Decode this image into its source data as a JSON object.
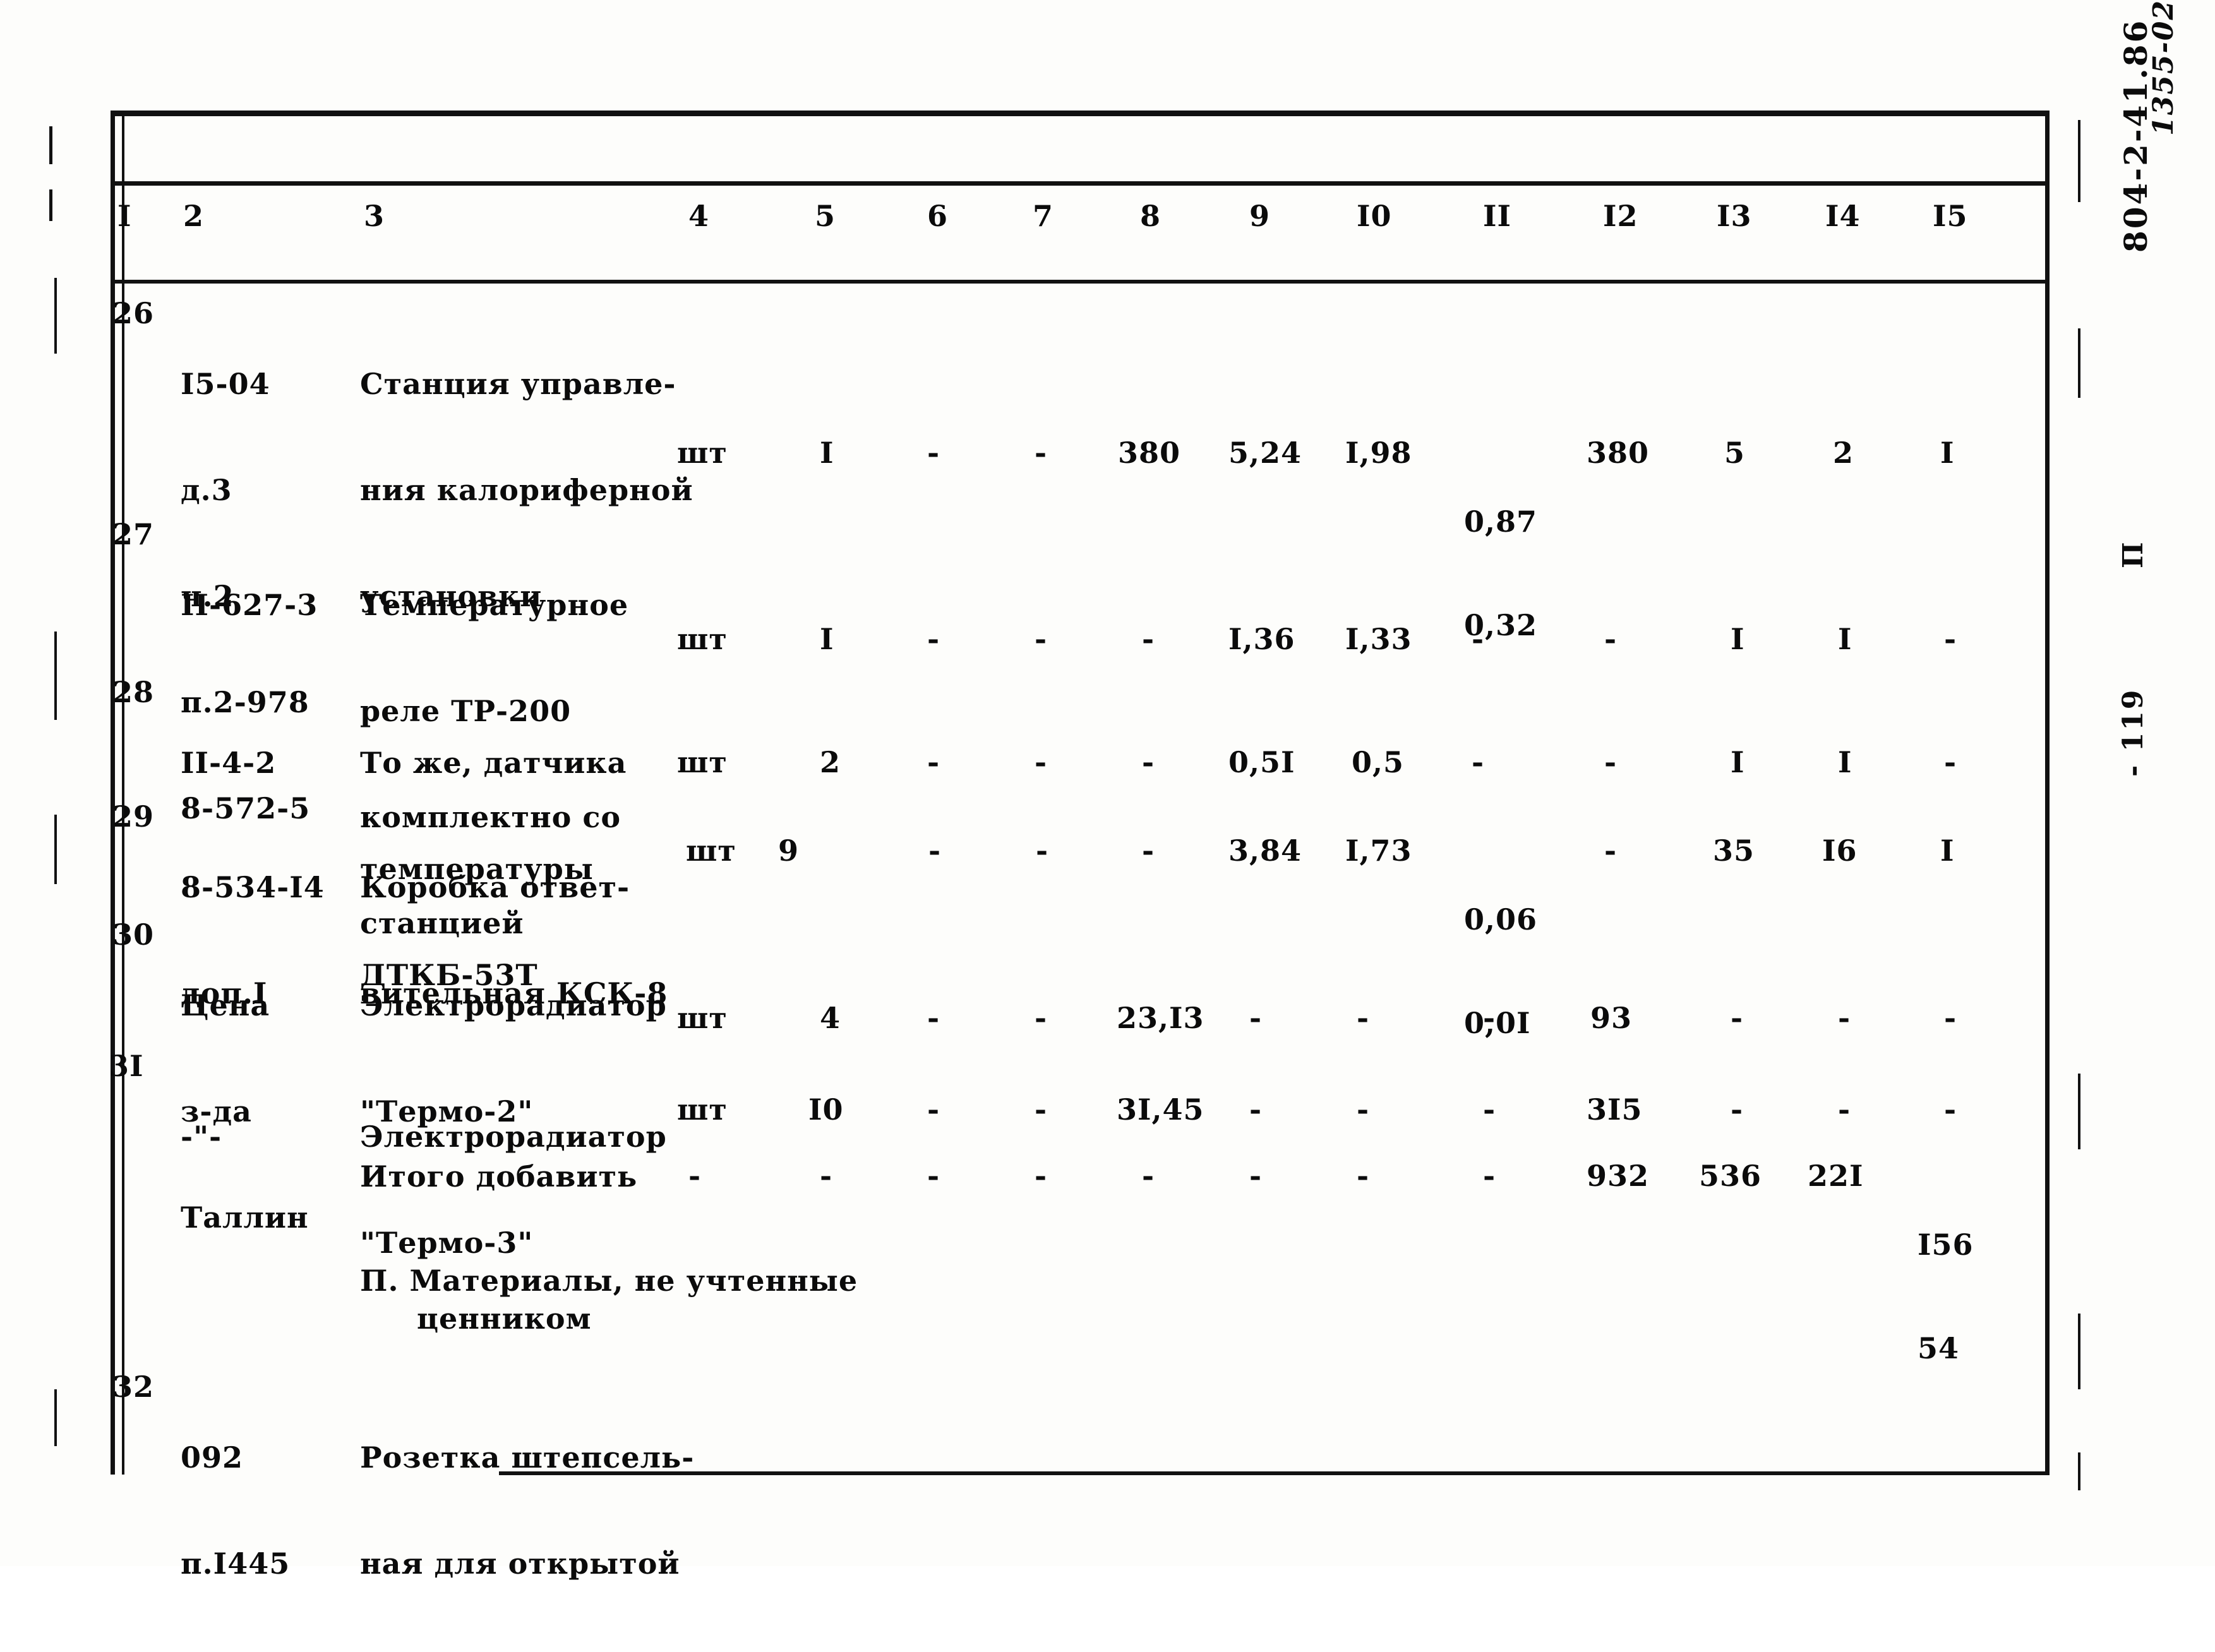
{
  "document": {
    "margin_note_handwritten": "1355-02",
    "margin_code": "804-2-41.86",
    "margin_section": "П",
    "margin_page": "- 119"
  },
  "table": {
    "column_headers": [
      "I",
      "2",
      "3",
      "4",
      "5",
      "6",
      "7",
      "8",
      "9",
      "I0",
      "II",
      "I2",
      "I3",
      "I4",
      "I5"
    ],
    "rows": [
      {
        "no": "26",
        "code_lines": [
          "I5-04",
          "д.3",
          "ч.2",
          "п.2-978",
          "8-572-5"
        ],
        "name_lines": [
          "Станция управле-",
          "ния калориферной",
          "установки"
        ],
        "unit": "шт",
        "c5": "I",
        "c6": "-",
        "c7": "-",
        "c8": "380",
        "c9": "5,24",
        "c10": "I,98",
        "c11": "0,87",
        "c11b": "0,32",
        "c12": "380",
        "c13": "5",
        "c14": "2",
        "c15": "I"
      },
      {
        "no": "27",
        "code_lines": [
          "II-627-3"
        ],
        "name_lines": [
          "Температурное",
          "реле ТР-200",
          "комплектно со",
          "станцией"
        ],
        "unit": "шт",
        "c5": "I",
        "c6": "-",
        "c7": "-",
        "c8": "-",
        "c9": "I,36",
        "c10": "I,33",
        "c11": "-",
        "c11b": "",
        "c12": "-",
        "c13": "I",
        "c14": "I",
        "c15": "-"
      },
      {
        "no": "28",
        "code_lines": [
          "II-4-2"
        ],
        "name_lines": [
          "То же, датчика",
          "температуры",
          "ДТКБ-53Т"
        ],
        "unit": "шт",
        "c5": "2",
        "c6": "-",
        "c7": "-",
        "c8": "-",
        "c9": "0,5I",
        "c10": "0,5",
        "c11": "-",
        "c11b": "",
        "c12": "-",
        "c13": "I",
        "c14": "I",
        "c15": "-"
      },
      {
        "no": "29",
        "code_lines": [
          "8-534-I4",
          "доп.I"
        ],
        "name_lines": [
          "Коробка ответ-",
          "вительная КСК-8"
        ],
        "unit": "шт",
        "c5": "9",
        "c6": "-",
        "c7": "-",
        "c8": "-",
        "c9": "3,84",
        "c10": "I,73",
        "c11": "0,06",
        "c11b": "0,0I",
        "c12": "-",
        "c13": "35",
        "c14": "I6",
        "c15": "I"
      },
      {
        "no": "30",
        "code_lines": [
          "Цена",
          "з-да",
          "Таллин"
        ],
        "name_lines": [
          "Электрорадиатор",
          "\"Термо-2\""
        ],
        "unit": "шт",
        "c5": "4",
        "c6": "-",
        "c7": "-",
        "c8": "23,I3",
        "c9": "-",
        "c10": "-",
        "c11": "-",
        "c11b": "",
        "c12": "93",
        "c13": "-",
        "c14": "-",
        "c15": "-"
      },
      {
        "no": "3I",
        "code_lines": [
          "-\"-"
        ],
        "name_lines": [
          "Электрорадиатор",
          "\"Термо-3\""
        ],
        "unit": "шт",
        "c5": "I0",
        "c6": "-",
        "c7": "-",
        "c8": "3I,45",
        "c9": "-",
        "c10": "-",
        "c11": "-",
        "c11b": "",
        "c12": "3I5",
        "c13": "-",
        "c14": "-",
        "c15": "-"
      }
    ],
    "total_row": {
      "label": "Итого добавить",
      "c4": "-",
      "c5": "-",
      "c6": "-",
      "c7": "-",
      "c8": "-",
      "c9": "-",
      "c10": "-",
      "c11": "-",
      "c12": "932",
      "c13": "536",
      "c14": "22I",
      "c15": "I56",
      "c15b": "54"
    },
    "section_heading": {
      "line1": "П. Материалы, не учтенные",
      "line2": "ценником"
    },
    "last_row": {
      "no": "32",
      "code_lines": [
        "092",
        "п.I445"
      ],
      "name_lines": [
        "Розетка штепсель-",
        "ная для открытой"
      ]
    }
  }
}
